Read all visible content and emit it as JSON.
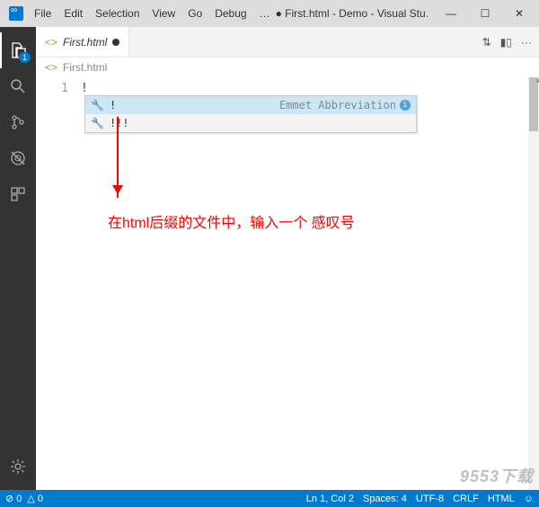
{
  "titlebar": {
    "title": "● First.html - Demo - Visual Stu…",
    "window_controls": {
      "min": "—",
      "max": "☐",
      "close": "✕"
    }
  },
  "menu": [
    "File",
    "Edit",
    "Selection",
    "View",
    "Go",
    "Debug",
    "…"
  ],
  "activitybar": {
    "explorer_badge": "1"
  },
  "tab": {
    "icon": "<>",
    "name": "First.html"
  },
  "tabbar_actions": {
    "compare": "⇅",
    "split": "▮▯",
    "more": "···"
  },
  "breadcrumb": {
    "icon": "<>",
    "name": "First.html"
  },
  "editor": {
    "line1_number": "1",
    "line1_code": "!",
    "annotation": "在html后缀的文件中，输入一个 感叹号"
  },
  "suggest": {
    "rows": [
      {
        "label": "!",
        "doc": "Emmet Abbreviation"
      },
      {
        "label": "!!!",
        "doc": ""
      }
    ],
    "info": "i"
  },
  "statusbar": {
    "errors": "⊘ 0",
    "warnings": "△ 0",
    "ln_col": "Ln 1, Col 2",
    "spaces": "Spaces: 4",
    "encoding": "UTF-8",
    "eol": "CRLF",
    "lang": "HTML",
    "feedback": "☺"
  },
  "watermark": "9553下载"
}
